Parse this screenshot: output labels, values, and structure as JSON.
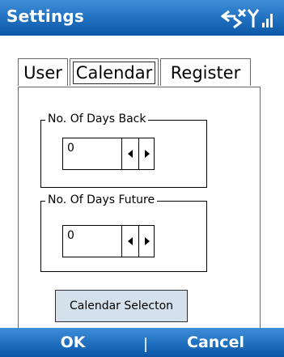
{
  "title_bar": {
    "title": "Settings",
    "icons": [
      "connectivity-icon",
      "signal-strength-icon"
    ]
  },
  "tabs": [
    {
      "label": "User",
      "selected": false
    },
    {
      "label": "Calendar",
      "selected": true
    },
    {
      "label": "Register",
      "selected": false
    }
  ],
  "days_back": {
    "label": "No. Of Days Back",
    "value": "0"
  },
  "days_future": {
    "label": "No. Of Days Future",
    "value": "0"
  },
  "calendar_selection_button": {
    "label": "Calendar Selecton"
  },
  "soft_keys": {
    "left": "OK",
    "right": "Cancel"
  },
  "colors": {
    "bar_blue": "#1f6fbf",
    "button_face": "#d4e0ec"
  }
}
